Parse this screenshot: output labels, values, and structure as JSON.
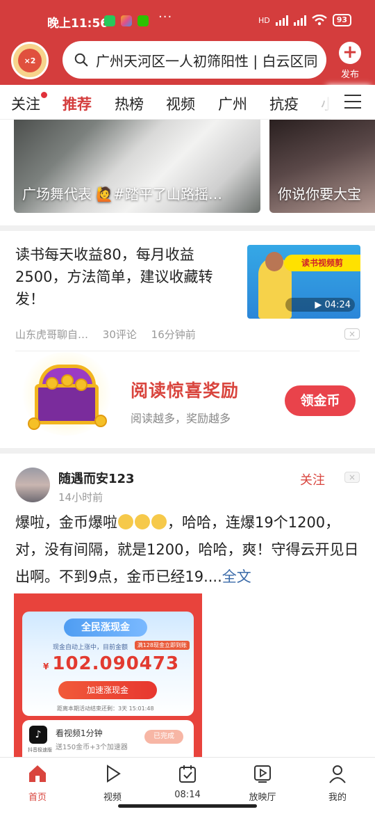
{
  "status_bar": {
    "time": "晚上11:56",
    "network": "HD",
    "battery": "93",
    "dots": "···"
  },
  "header": {
    "logo_text": "×2",
    "search_text": "广州天河区一人初筛阳性 | 白云区同",
    "publish_label": "发布",
    "publish_symbol": "+"
  },
  "tabs": [
    {
      "label": "关注"
    },
    {
      "label": "推荐"
    },
    {
      "label": "热榜"
    },
    {
      "label": "视频"
    },
    {
      "label": "广州"
    },
    {
      "label": "抗疫"
    },
    {
      "label": "小"
    }
  ],
  "video_strip": [
    {
      "title": "广场舞代表 🙋#踏平了山路摇…"
    },
    {
      "title": "你说你要大宝"
    }
  ],
  "article": {
    "title": "读书每天收益80，每月收益2500，方法简单，建议收藏转发！",
    "thumb_ribbon": "读书视频剪",
    "duration": "▶ 04:24",
    "source": "山东虎哥聊自…",
    "comments": "30评论",
    "time": "16分钟前",
    "close": "×"
  },
  "reward": {
    "title": "阅读惊喜奖励",
    "subtitle": "阅读越多，奖励越多",
    "button": "领金币"
  },
  "post": {
    "username": "随遇而安123",
    "time": "14小时前",
    "follow": "关注",
    "close": "×",
    "text_a": "爆啦，金币爆啦",
    "text_b": "，哈哈，连爆19个1200，对，没有间隔，就是1200，哈哈，爽！守得云开见日出啊。不到9点，金币已经19....",
    "more": "全文",
    "image": {
      "banner": "全民涨现金",
      "small": "现金自动上涨中，目前金额",
      "badge": "满128现金立即到账",
      "currency": "¥",
      "amount": "102.090473",
      "button": "加速涨现金",
      "countdown": "距离本期活动结束还剩：3天 15:01:48",
      "tt_sub": "抖音极速版",
      "task_title": "看视频1分钟",
      "task_sub": "送150金币+3个加速器",
      "task_done": "已完成"
    }
  },
  "bottom_nav": [
    {
      "label": "首页",
      "icon": "home-icon"
    },
    {
      "label": "视频",
      "icon": "play-icon"
    },
    {
      "label": "08:14",
      "icon": "calendar-check-icon"
    },
    {
      "label": "放映厅",
      "icon": "screen-play-icon"
    },
    {
      "label": "我的",
      "icon": "user-icon"
    }
  ],
  "colors": {
    "brand_red": "#d43d3d",
    "accent_red": "#e9434b",
    "link_blue": "#3a6aa8"
  }
}
